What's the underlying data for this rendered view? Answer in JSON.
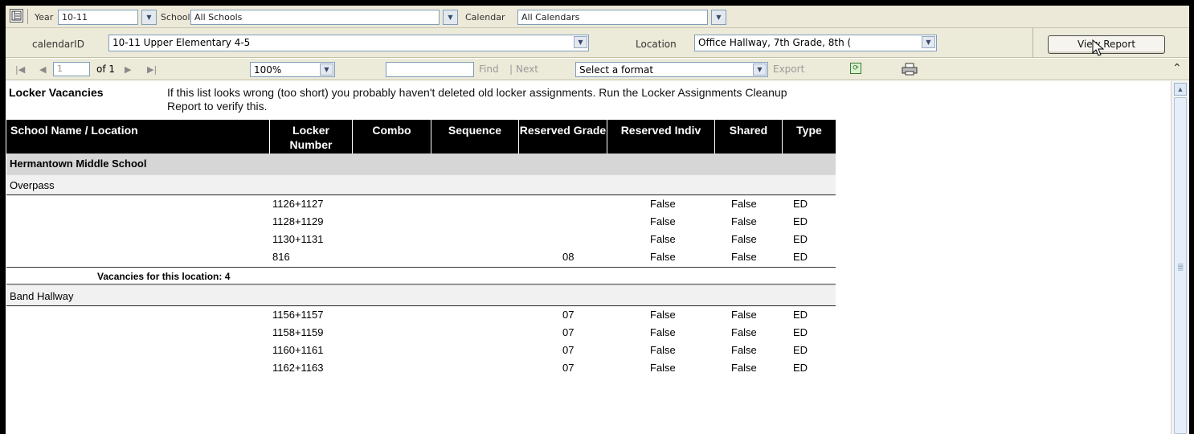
{
  "filters": {
    "year_label": "Year",
    "year_value": "10-11",
    "school_label": "School",
    "school_value": "All Schools",
    "calendar_label": "Calendar",
    "calendar_value": "All Calendars"
  },
  "params": {
    "calendarid_label": "calendarID",
    "calendarid_value": "10-11 Upper Elementary 4-5",
    "location_label": "Location",
    "location_value": "Office Hallway, 7th Grade, 8th (",
    "view_report": "View Report"
  },
  "toolbar": {
    "page": "1",
    "of": "of 1",
    "zoom": "100%",
    "find": "Find",
    "sep": "|",
    "next": "Next",
    "format": "Select a format",
    "export": "Export"
  },
  "report": {
    "title": "Locker Vacancies",
    "note": "If this list looks wrong (too short) you probably haven't deleted old locker assignments. Run the Locker Assignments Cleanup Report to verify this.",
    "columns": [
      "School Name / Location",
      "Locker Number",
      "Combo",
      "Sequence",
      "Reserved Grade",
      "Reserved Indiv",
      "Shared",
      "Type"
    ],
    "school": "Hermantown Middle School",
    "groups": [
      {
        "location": "Overpass",
        "rows": [
          {
            "locker": "1126+1127",
            "grade": "",
            "indiv": "False",
            "shared": "False",
            "type": "ED"
          },
          {
            "locker": "1128+1129",
            "grade": "",
            "indiv": "False",
            "shared": "False",
            "type": "ED"
          },
          {
            "locker": "1130+1131",
            "grade": "",
            "indiv": "False",
            "shared": "False",
            "type": "ED"
          },
          {
            "locker": "816",
            "grade": "08",
            "indiv": "False",
            "shared": "False",
            "type": "ED"
          }
        ],
        "total_label": "Vacancies for this location: 4"
      },
      {
        "location": "Band Hallway",
        "rows": [
          {
            "locker": "1156+1157",
            "grade": "07",
            "indiv": "False",
            "shared": "False",
            "type": "ED"
          },
          {
            "locker": "1158+1159",
            "grade": "07",
            "indiv": "False",
            "shared": "False",
            "type": "ED"
          },
          {
            "locker": "1160+1161",
            "grade": "07",
            "indiv": "False",
            "shared": "False",
            "type": "ED"
          },
          {
            "locker": "1162+1163",
            "grade": "07",
            "indiv": "False",
            "shared": "False",
            "type": "ED"
          }
        ]
      }
    ]
  }
}
